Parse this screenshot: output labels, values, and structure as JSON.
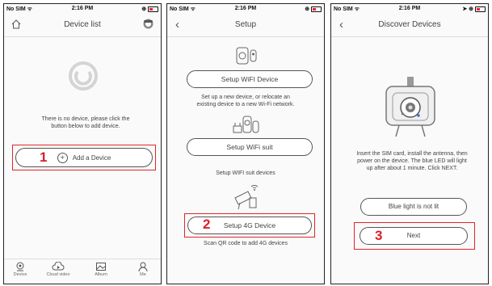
{
  "status_bar": {
    "carrier": "No SIM",
    "time": "2:16 PM"
  },
  "screen1": {
    "title": "Device list",
    "empty_message": "There is no device, please click the button below to add device.",
    "add_button": "Add a Device",
    "step": "1",
    "tabs": [
      {
        "label": "Device",
        "icon": "camera-icon"
      },
      {
        "label": "Cloud video",
        "icon": "cloud-icon"
      },
      {
        "label": "Album",
        "icon": "album-icon"
      },
      {
        "label": "Me",
        "icon": "person-icon"
      }
    ]
  },
  "screen2": {
    "title": "Setup",
    "wifi_device_button": "Setup WiFI Device",
    "wifi_device_desc": "Set up a new device, or relocate an existing device to a new Wi-Fi network.",
    "wifi_suit_button": "Setup WiFi suit",
    "wifi_suit_desc": "Setup WIFI suit devices",
    "g4_button": "Setup 4G Device",
    "g4_desc": "Scan QR code to add 4G devices",
    "step": "2"
  },
  "screen3": {
    "title": "Discover Devices",
    "instructions": "Insert the SIM card, install the antenna, then power on the device. The blue LED will light up after about 1 minute. Click NEXT.",
    "blue_light_button": "Blue light is not lit",
    "next_button": "Next",
    "step": "3"
  },
  "colors": {
    "highlight": "#e0252a",
    "step_number": "#d9202a"
  }
}
